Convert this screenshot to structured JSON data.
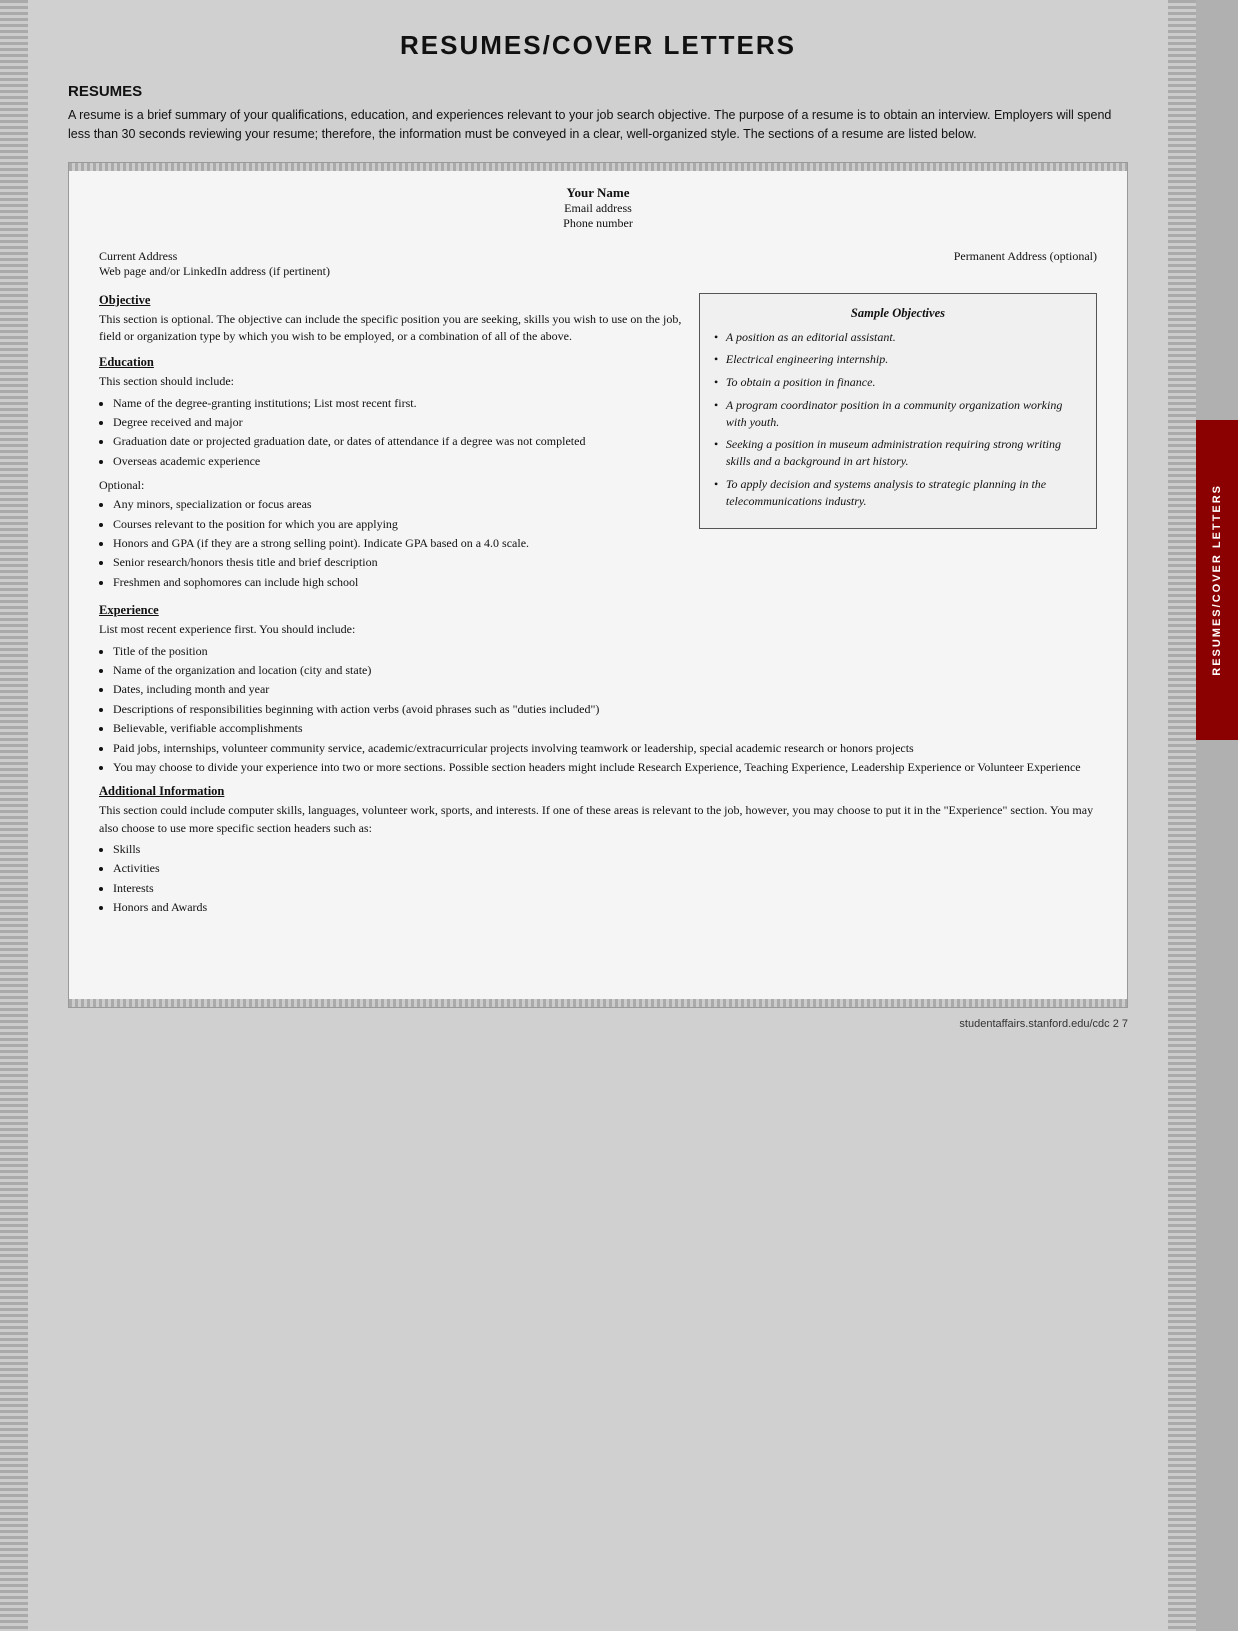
{
  "page": {
    "title": "RESUMES/COVER LETTERS",
    "footer": "studentaffairs.stanford.edu/cdc     2 7"
  },
  "side_tab": {
    "text": "RESUMES/COVER LETTERS"
  },
  "resumes_section": {
    "heading": "RESUMES",
    "intro": "A resume is a brief summary of your qualifications, education, and experiences relevant to your job search objective. The purpose of a resume is to obtain an interview. Employers will spend less than 30 seconds reviewing your resume; therefore, the information must be conveyed in a clear, well-organized style. The sections of a resume are listed below."
  },
  "resume_template": {
    "name": "Your Name",
    "email": "Email address",
    "phone": "Phone number",
    "current_address_label": "Current Address",
    "web_label": "Web page and/or LinkedIn address (if pertinent)",
    "permanent_address_label": "Permanent Address (optional)",
    "objective_heading": "Objective",
    "objective_text": "This section is optional. The objective can include the specific position you are seeking, skills you wish to use on the job, field or organization type by which you wish to be employed, or a combination of all of the above.",
    "education_heading": "Education",
    "education_intro": "This section should include:",
    "education_bullets": [
      "Name of the degree-granting institutions; List most recent first.",
      "Degree received and major",
      "Graduation date or projected graduation date, or dates of attendance if a degree was not completed",
      "Overseas academic experience"
    ],
    "optional_label": "Optional:",
    "optional_bullets": [
      "Any minors, specialization or focus areas",
      "Courses relevant to the position for which you are applying",
      "Honors and GPA (if they are a strong selling point). Indicate GPA based on a 4.0 scale.",
      "Senior research/honors thesis title and brief description",
      "Freshmen and sophomores can include high school"
    ],
    "experience_heading": "Experience",
    "experience_intro": "List most recent experience first. You should include:",
    "experience_bullets": [
      "Title of the position",
      "Name of the organization and location (city and state)",
      "Dates, including month and year",
      "Descriptions of responsibilities beginning with action verbs (avoid phrases such as \"duties included\")",
      "Believable, verifiable accomplishments",
      "Paid jobs, internships, volunteer community service, academic/extracurricular projects involving teamwork or leadership, special academic research or honors projects",
      "You may choose to divide your experience into two or more sections. Possible section headers might include Research Experience, Teaching Experience, Leadership Experience or Volunteer Experience"
    ],
    "additional_info_heading": "Additional Information",
    "additional_info_text": "This section could include computer skills, languages, volunteer work, sports, and interests. If one of these areas is relevant to the job, however, you may choose to put it in the \"Experience\" section. You may also choose to use more specific section headers such as:",
    "additional_info_bullets": [
      "Skills",
      "Activities",
      "Interests",
      "Honors and Awards"
    ]
  },
  "sample_objectives": {
    "title": "Sample Objectives",
    "items": [
      "A position as an editorial assistant.",
      "Electrical engineering internship.",
      "To obtain a position in finance.",
      "A program coordinator position in a community organization working with youth.",
      "Seeking a position in museum administration requiring strong writing skills and a background in art history.",
      "To apply decision and systems analysis to strategic planning in the telecommunications industry."
    ]
  }
}
